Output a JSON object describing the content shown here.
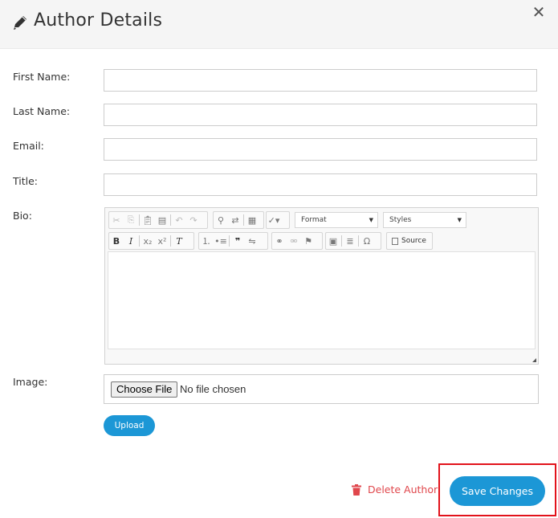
{
  "dialog": {
    "title": "Author Details",
    "close_symbol": "✕"
  },
  "fields": {
    "first_name": {
      "label": "First Name:",
      "value": ""
    },
    "last_name": {
      "label": "Last Name:",
      "value": ""
    },
    "email": {
      "label": "Email:",
      "value": ""
    },
    "title": {
      "label": "Title:",
      "value": ""
    },
    "bio": {
      "label": "Bio:"
    },
    "image": {
      "label": "Image:"
    }
  },
  "editor": {
    "format_label": "Format",
    "styles_label": "Styles",
    "source_label": "Source"
  },
  "file_input": {
    "button_label": "Choose File",
    "status": "No file chosen"
  },
  "buttons": {
    "upload": "Upload",
    "delete_author": "Delete Author",
    "save_changes": "Save Changes"
  },
  "icons": {
    "edit": "pencil-icon",
    "close": "close-icon",
    "delete": "trash-icon"
  },
  "colors": {
    "primary": "#1c97d6",
    "danger": "#e0474c",
    "highlight_frame": "#e2121b",
    "header_bg": "#f5f5f5"
  }
}
